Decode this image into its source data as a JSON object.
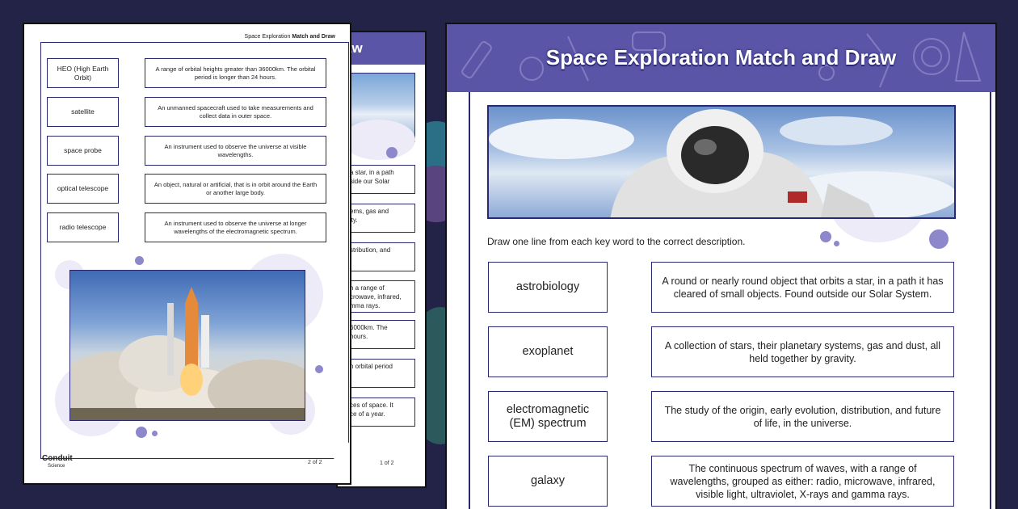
{
  "back_page": {
    "title_fragment": "aw",
    "fragments": [
      "a star, in a path\nside our Solar",
      "ems, gas and\nity.",
      "stribution, and",
      "h a range of\ncrowave, infrared,\nmma rays.",
      "6000km. The\nhours.",
      "n orbital period",
      "ces of space. It\nce of a year."
    ],
    "page_number": "1 of 2"
  },
  "front_page": {
    "header_prefix": "Space Exploration",
    "header_bold": "Match and Draw",
    "rows": [
      {
        "keyword": "HEO (High Earth Orbit)",
        "description": "A range of orbital heights greater than 36000km. The orbital period is longer than 24 hours."
      },
      {
        "keyword": "satellite",
        "description": "An unmanned spacecraft used to take measurements and collect data in outer space."
      },
      {
        "keyword": "space probe",
        "description": "An instrument used to observe the universe at visible wavelengths."
      },
      {
        "keyword": "optical telescope",
        "description": "An object, natural or artificial, that is in orbit around the Earth or another large body."
      },
      {
        "keyword": "radio telescope",
        "description": "An instrument used to observe the universe at longer wavelengths of the electromagnetic spectrum."
      }
    ],
    "logo_main": "Conduit",
    "logo_sub": "Science",
    "page_number": "2 of 2"
  },
  "right_page": {
    "title": "Space Exploration Match and Draw",
    "instruction": "Draw one line from each key word to the correct description.",
    "rows": [
      {
        "keyword": "astrobiology",
        "description": "A round or nearly round object that orbits a star, in a path it has cleared of small objects. Found outside our Solar System."
      },
      {
        "keyword": "exoplanet",
        "description": "A collection of stars, their planetary systems, gas and dust, all held together by gravity."
      },
      {
        "keyword": "electromagnetic (EM) spectrum",
        "description": "The study of the origin, early evolution, distribution, and future of life, in the universe."
      },
      {
        "keyword": "galaxy",
        "description": "The continuous spectrum of waves, with a range of wavelengths, grouped as either: radio, microwave, infrared, visible light, ultraviolet, X-rays and gamma rays."
      }
    ]
  },
  "colors": {
    "background": "#232247",
    "banner": "#5b55a8",
    "border": "#2a2870",
    "accent_circle": "#d9d6ef",
    "accent_dot": "#8d87cc"
  }
}
